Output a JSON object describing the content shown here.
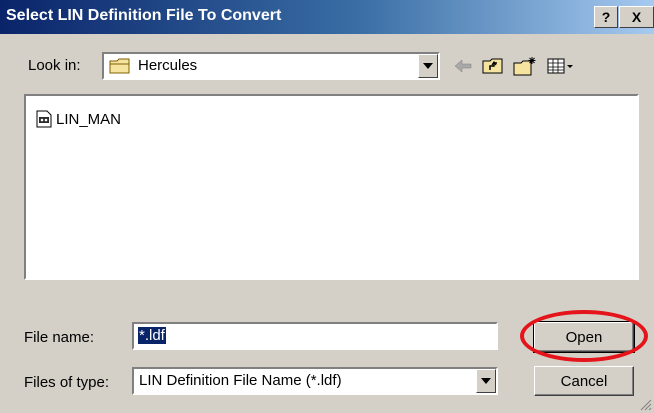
{
  "window": {
    "title": "Select LIN Definition File To Convert",
    "help_label": "?",
    "close_label": "X"
  },
  "lookin": {
    "label": "Look in:",
    "value": "Hercules"
  },
  "toolbar": {
    "icons": [
      "back-arrow-icon",
      "up-one-level-icon",
      "new-folder-icon",
      "view-menu-icon"
    ]
  },
  "files": [
    {
      "name": "LIN_MAN",
      "icon": "ldf-file-icon"
    }
  ],
  "filename": {
    "label": "File name:",
    "value": "*.ldf"
  },
  "filetype": {
    "label": "Files of type:",
    "value": "LIN Definition File Name (*.ldf)"
  },
  "buttons": {
    "open": "Open",
    "cancel": "Cancel"
  },
  "colors": {
    "title_start": "#0a246a",
    "title_end": "#a6caf0",
    "dialog_bg": "#d4d0c8",
    "highlight_ring": "#e4141a",
    "selection": "#0a246a"
  }
}
